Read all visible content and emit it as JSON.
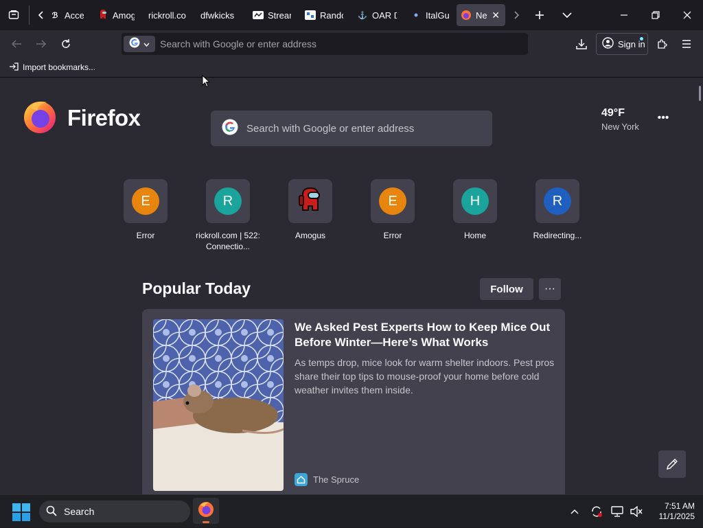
{
  "browser": {
    "tabs": [
      {
        "label": "Acces",
        "icon": "tab-favicon"
      },
      {
        "label": "Amog",
        "icon": "amogus-favicon"
      },
      {
        "label": "rickroll.co",
        "icon": "none"
      },
      {
        "label": "dfwkicks",
        "icon": "none"
      },
      {
        "label": "Stream",
        "icon": "stream-favicon"
      },
      {
        "label": "Rando",
        "icon": "random-favicon"
      },
      {
        "label": "OAR D",
        "icon": "oar-favicon"
      },
      {
        "label": "ItalGu",
        "icon": "italgu-favicon"
      },
      {
        "label": "Ne",
        "icon": "firefox-favicon",
        "active": true
      }
    ],
    "url_placeholder": "Search with Google or enter address",
    "sign_in": "Sign in",
    "bookmark_import": "Import bookmarks..."
  },
  "newtab": {
    "brand": "Firefox",
    "search_placeholder": "Search with Google or enter address",
    "weather": {
      "temp": "49°F",
      "city": "New York"
    },
    "top_sites": [
      {
        "letter": "E",
        "label": "Error",
        "color": "#f9a01b",
        "kind": "letter"
      },
      {
        "letter": "R",
        "label": "rickroll.com | 522: Connectio...",
        "color": "#1cb0a8",
        "kind": "letter"
      },
      {
        "letter": "",
        "label": "Amogus",
        "color": "#c81e1e",
        "kind": "amogus"
      },
      {
        "letter": "E",
        "label": "Error",
        "color": "#f9a01b",
        "kind": "letter"
      },
      {
        "letter": "H",
        "label": "Home",
        "color": "#1cb0a8",
        "kind": "letter"
      },
      {
        "letter": "R",
        "label": "Redirecting...",
        "color": "#0060df",
        "kind": "letter"
      }
    ],
    "popular": {
      "title": "Popular Today",
      "follow": "Follow",
      "card": {
        "headline": "We Asked Pest Experts How to Keep Mice Out Before Winter—Here’s What Works",
        "excerpt": "As temps drop, mice look for warm shelter indoors. Pest pros share their top tips to mouse-proof your home before cold weather invites them inside.",
        "source": "The Spruce"
      }
    }
  },
  "taskbar": {
    "search": "Search",
    "time": "7:51 AM",
    "date": "11/1/2025"
  }
}
